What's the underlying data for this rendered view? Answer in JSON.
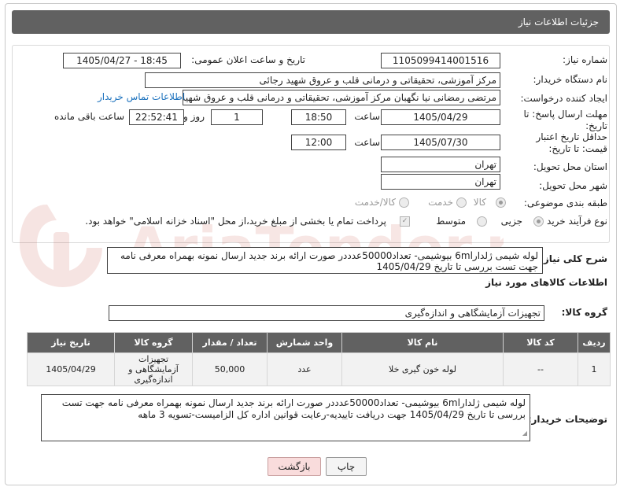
{
  "header": {
    "title": "جزئیات اطلاعات نیاز"
  },
  "form": {
    "need_number_label": "شماره نیاز:",
    "need_number": "1105099414001516",
    "announce_label": "تاریخ و ساعت اعلان عمومی:",
    "announce_value": "1405/04/27 - 18:45",
    "buyer_org_label": "نام دستگاه خریدار:",
    "buyer_org": "مرکز آموزشی، تحقیقاتی و درمانی قلب و عروق شهید رجائی",
    "creator_label": "ایجاد کننده درخواست:",
    "creator": "مرتضی رمضانی نیا نگهبان مرکز آموزشی، تحقیقاتی و درمانی قلب و عروق شهید رجائی",
    "contact_link": "اطلاعات تماس خریدار",
    "deadline_label": "مهلت ارسال پاسخ: تا تاریخ:",
    "deadline_date": "1405/04/29",
    "hour_label": "ساعت",
    "deadline_time": "18:50",
    "days_count": "1",
    "day_and_label": "روز و",
    "remaining_time": "22:52:41",
    "remaining_label": "ساعت باقی مانده",
    "validity_label": "حداقل تاریخ اعتبار قیمت: تا تاریخ:",
    "validity_date": "1405/07/30",
    "validity_time": "12:00",
    "province_label": "استان محل تحویل:",
    "province": "تهران",
    "city_label": "شهر محل تحویل:",
    "city": "تهران",
    "category_label": "طبقه بندی موضوعی:",
    "category_options": [
      "کالا",
      "خدمت",
      "کالا/خدمت"
    ],
    "category_selected": "کالا",
    "process_label": "نوع فرآیند خرید :",
    "process_options": [
      "جزیی",
      "متوسط"
    ],
    "process_selected": "جزیی",
    "payment_note": "پرداخت تمام یا بخشی از مبلغ خرید،از محل \"اسناد خزانه اسلامی\" خواهد بود."
  },
  "description": {
    "label": "شرح کلی نیاز:",
    "text": "لوله شیمی ژلدار6ml بیوشیمی- تعداد50000عدددر صورت ارائه برند جدید ارسال نمونه بهمراه معرفی نامه جهت تست  بررسی  تا تاریخ 1405/04/29"
  },
  "goods": {
    "section_title": "اطلاعات کالاهای مورد نیاز",
    "group_label": "گروه کالا:",
    "group_value": "تجهیزات آزمایشگاهی و اندازه‌گیری",
    "columns": [
      "ردیف",
      "کد کالا",
      "نام کالا",
      "واحد شمارش",
      "تعداد / مقدار",
      "گروه کالا",
      "تاریخ نیاز"
    ],
    "rows": [
      {
        "index": "1",
        "code": "--",
        "name": "لوله خون گیری خلا",
        "unit": "عدد",
        "quantity": "50,000",
        "group": "تجهیزات آزمایشگاهی و اندازه‌گیری",
        "date": "1405/04/29"
      }
    ]
  },
  "buyer_notes": {
    "label": "توضیحات خریدار:",
    "text": "لوله شیمی ژلدار6ml بیوشیمی- تعداد50000عدددر صورت ارائه برند جدید ارسال نمونه بهمراه معرفی نامه جهت تست  بررسی  تا تاریخ 1405/04/29 جهت دریافت تاییدیه-رعایت قوانین اداره کل الزامیست-تسویه 3 ماهه"
  },
  "buttons": {
    "print": "چاپ",
    "back": "بازگشت"
  },
  "watermark": {
    "text": "AriaTender.neT"
  },
  "colors": {
    "header_bg": "#616161",
    "link": "#1e73be",
    "back_button": "#f9dcdc"
  }
}
